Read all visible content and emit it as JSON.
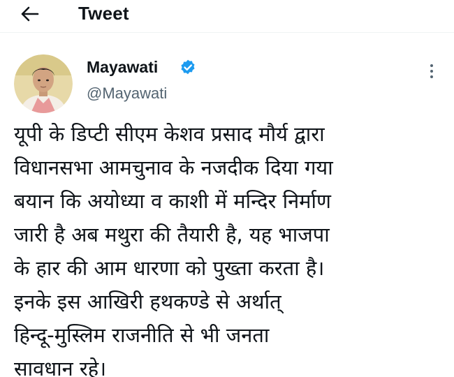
{
  "header": {
    "title": "Tweet",
    "back_icon": "arrow-left-icon"
  },
  "tweet": {
    "author": {
      "name": "Mayawati",
      "handle": "@Mayawati",
      "verified": true,
      "verified_color": "#1d9bf0"
    },
    "more_icon": "more-vertical-icon",
    "lines": [
      "यूपी के डिप्टी सीएम केशव प्रसाद मौर्य द्वारा",
      "विधानसभा आमचुनाव के नजदीक दिया गया",
      "बयान कि अयोध्या व काशी में मन्दिर निर्माण",
      "जारी है अब मथुरा की तैयारी है, यह भाजपा",
      "के हार की आम धारणा को पुख्ता करता है।",
      "इनके इस आखिरी हथकण्डे से अर्थात्",
      "हिन्दू-मुस्लिम राजनीति से भी जनता",
      "सावधान रहे।"
    ]
  },
  "colors": {
    "text_primary": "#0f1419",
    "text_secondary": "#536471",
    "background": "#ffffff"
  }
}
